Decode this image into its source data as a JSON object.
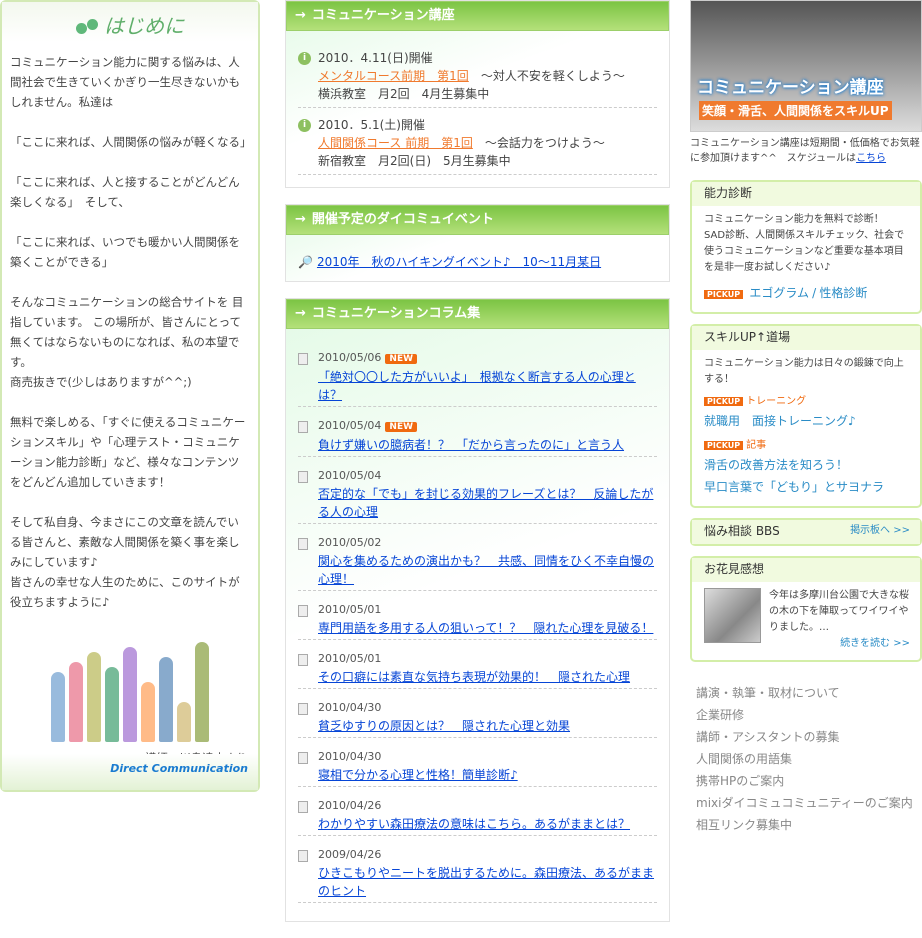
{
  "intro": {
    "title": "はじめに",
    "paragraphs": [
      "コミュニケーション能力に関する悩みは、人間社会で生きていくかぎり一生尽きないかもしれません。私達は",
      "「ここに来れば、人間関係の悩みが軽くなる」",
      "「ここに来れば、人と接することがどんどん楽しくなる」　そして、",
      "「ここに来れば、いつでも暖かい人間関係を築くことができる」",
      "そんなコミュニケーションの総合サイトを 目指しています。 この場所が、皆さんにとって無くてはならないものになれば、私の本望です。\n商売抜きで(少しはありますが^^;)",
      "無料で楽しめる、「すぐに使えるコミュニケーションスキル」や「心理テスト・コミュニケーション能力診断」など、様々なコンテンツをどんどん追加していきます！",
      "そして私自身、今まさにこの文章を読んでいる皆さんと、素敵な人間関係を築く事を楽しみにしています♪\n皆さんの幸せな人生のために、このサイトが役立ちますように♪"
    ],
    "signature": "講師　川島達史より",
    "logo": "Direct Communication"
  },
  "courses": {
    "title": "コミュニケーション講座",
    "items": [
      {
        "date": "2010．4.11(日)開催",
        "link": "メンタルコース前期　第1回",
        "sub": "～対人不安を軽くしよう～",
        "info": "横浜教室　月2回　4月生募集中"
      },
      {
        "date": "2010．5.1(土)開催",
        "link": "人間関係コース 前期　第1回",
        "sub": "～会話力をつけよう～",
        "info": "新宿教室　月2回(日)　5月生募集中"
      }
    ]
  },
  "events": {
    "title": "開催予定のダイコミュイベント",
    "items": [
      "2010年　秋のハイキングイベント♪　10～11月某日"
    ]
  },
  "columns": {
    "title": "コミュニケーションコラム集",
    "new_label": "NEW",
    "items": [
      {
        "date": "2010/05/06",
        "new": true,
        "title": "「絶対〇〇した方がいいよ」　根拠なく断言する人の心理とは？"
      },
      {
        "date": "2010/05/04",
        "new": true,
        "title": "負けず嫌いの臆病者！？　「だから言ったのに」と言う人"
      },
      {
        "date": "2010/05/04",
        "new": false,
        "title": "否定的な「でも」を封じる効果的フレーズとは？　反論したがる人の心理"
      },
      {
        "date": "2010/05/02",
        "new": false,
        "title": "関心を集めるための演出かも？　共感、同情をひく不幸自慢の心理！"
      },
      {
        "date": "2010/05/01",
        "new": false,
        "title": "専門用語を多用する人の狙いって！？　隠れた心理を見破る！"
      },
      {
        "date": "2010/05/01",
        "new": false,
        "title": "その口癖には素直な気持ち表現が効果的！　隠された心理"
      },
      {
        "date": "2010/04/30",
        "new": false,
        "title": "貧乏ゆすりの原因とは？　隠された心理と効果"
      },
      {
        "date": "2010/04/30",
        "new": false,
        "title": "寝相で分かる心理と性格！簡単診断♪"
      },
      {
        "date": "2010/04/26",
        "new": false,
        "title": "わかりやすい森田療法の意味はこちら。あるがままとは？"
      },
      {
        "date": "2009/04/26",
        "new": false,
        "title": "ひきこもりやニートを脱出するために。森田療法、あるがままのヒント"
      }
    ]
  },
  "right": {
    "banner": {
      "title": "コミュニケーション講座",
      "subtitle": "笑顔・滑舌、人間関係をスキルUP"
    },
    "intro_text": "コミュニケーション講座は短期間・低価格でお気軽に参加頂けます^^　スケジュールは",
    "intro_link": "こちら",
    "pickup": "PICKUP",
    "diagnosis": {
      "title": "能力診断",
      "text": "コミュニケーション能力を無料で診断！\nSAD診断、人間関係スキルチェック、社会で使うコミュニケーションなど重要な基本項目を是非一度お試しください♪",
      "link1": "エゴグラム",
      "sep": "/",
      "link2": "性格診断"
    },
    "skillup": {
      "title": "スキルUP↑道場",
      "text": "コミュニケーション能力は日々の鍛錬で向上する！",
      "tag1": "トレーニング",
      "link1": "就職用　面接トレーニング♪",
      "tag2": "記事",
      "link2": "滑舌の改善方法を知ろう！",
      "link3": "早口言葉で「どもり」とサヨナラ"
    },
    "bbs": {
      "title": "悩み相談 BBS",
      "link": "掲示板へ >>"
    },
    "hanami": {
      "title": "お花見感想",
      "text": "今年は多摩川台公園で大きな桜の木の下を陣取ってワイワイやりました。…",
      "more": "続きを読む >>"
    },
    "links": [
      "講演・執筆・取材について",
      "企業研修",
      "講師・アシスタントの募集",
      "人間関係の用語集",
      "携帯HPのご案内",
      "mixiダイコミュコミュニティーのご案内",
      "相互リンク募集中"
    ]
  }
}
